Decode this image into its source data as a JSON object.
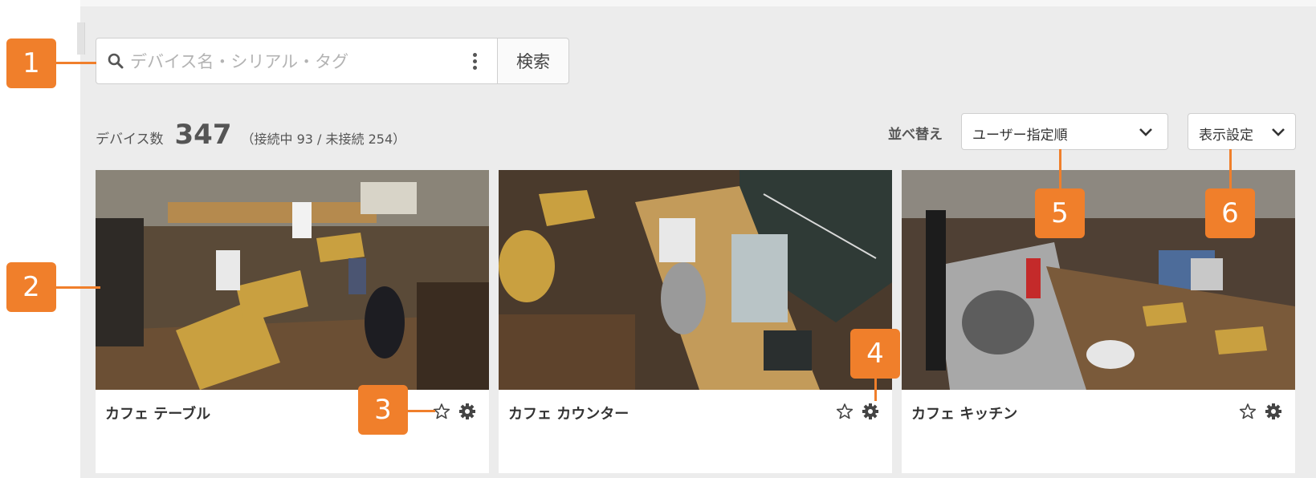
{
  "search": {
    "placeholder": "デバイス名・シリアル・タグ",
    "button_label": "検索"
  },
  "summary": {
    "label": "デバイス数",
    "total": "347",
    "detail": "（接続中 93 / 未接続 254）"
  },
  "sort": {
    "label": "並べ替え",
    "selected": "ユーザー指定順"
  },
  "display_settings": {
    "label": "表示設定"
  },
  "devices": [
    {
      "name": "カフェ テーブル"
    },
    {
      "name": "カフェ カウンター"
    },
    {
      "name": "カフェ キッチン"
    }
  ],
  "callouts": [
    "1",
    "2",
    "3",
    "4",
    "5",
    "6"
  ],
  "colors": {
    "accent": "#f07f2b",
    "panel": "#ececec"
  }
}
